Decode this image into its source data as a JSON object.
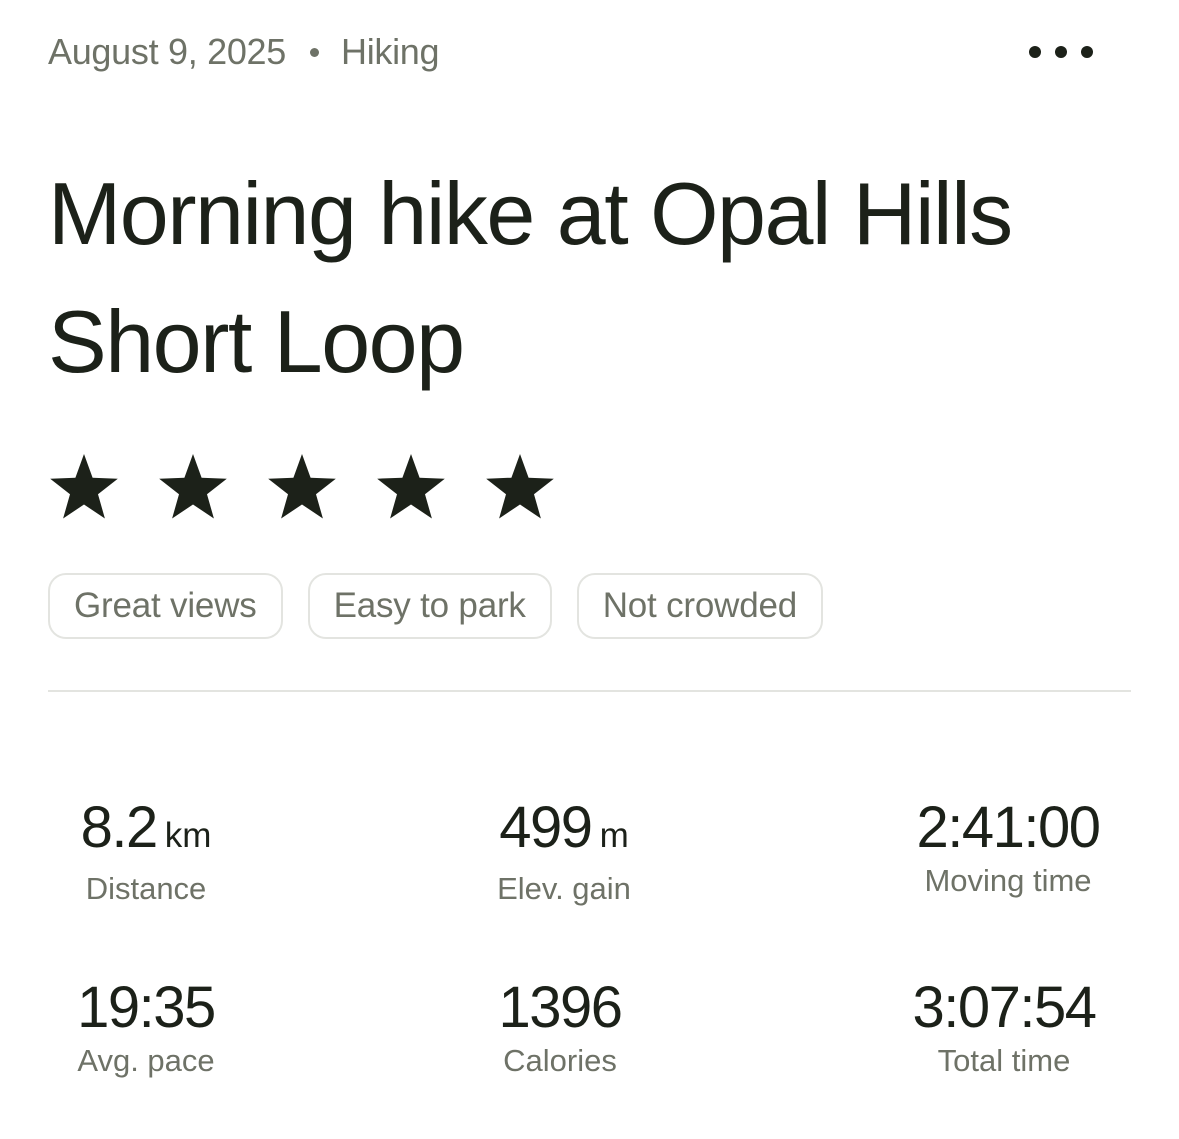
{
  "header": {
    "date": "August 9, 2025",
    "activity_type": "Hiking",
    "more_icon": "more-horizontal-icon"
  },
  "activity": {
    "title": "Morning hike at Opal Hills Short Loop",
    "rating": 5,
    "rating_max": 5,
    "tags": [
      "Great views",
      "Easy to park",
      "Not crowded"
    ]
  },
  "stats": [
    {
      "value": "8.2",
      "unit": "km",
      "label": "Distance"
    },
    {
      "value": "499",
      "unit": "m",
      "label": "Elev. gain"
    },
    {
      "value": "2:41:00",
      "unit": "",
      "label": "Moving time"
    },
    {
      "value": "19:35",
      "unit": "",
      "label": "Avg. pace"
    },
    {
      "value": "1396",
      "unit": "",
      "label": "Calories"
    },
    {
      "value": "3:07:54",
      "unit": "",
      "label": "Total time"
    }
  ],
  "colors": {
    "text_primary": "#1c2119",
    "text_secondary": "#6e7267",
    "border": "#e3e4e0",
    "background": "#ffffff"
  }
}
